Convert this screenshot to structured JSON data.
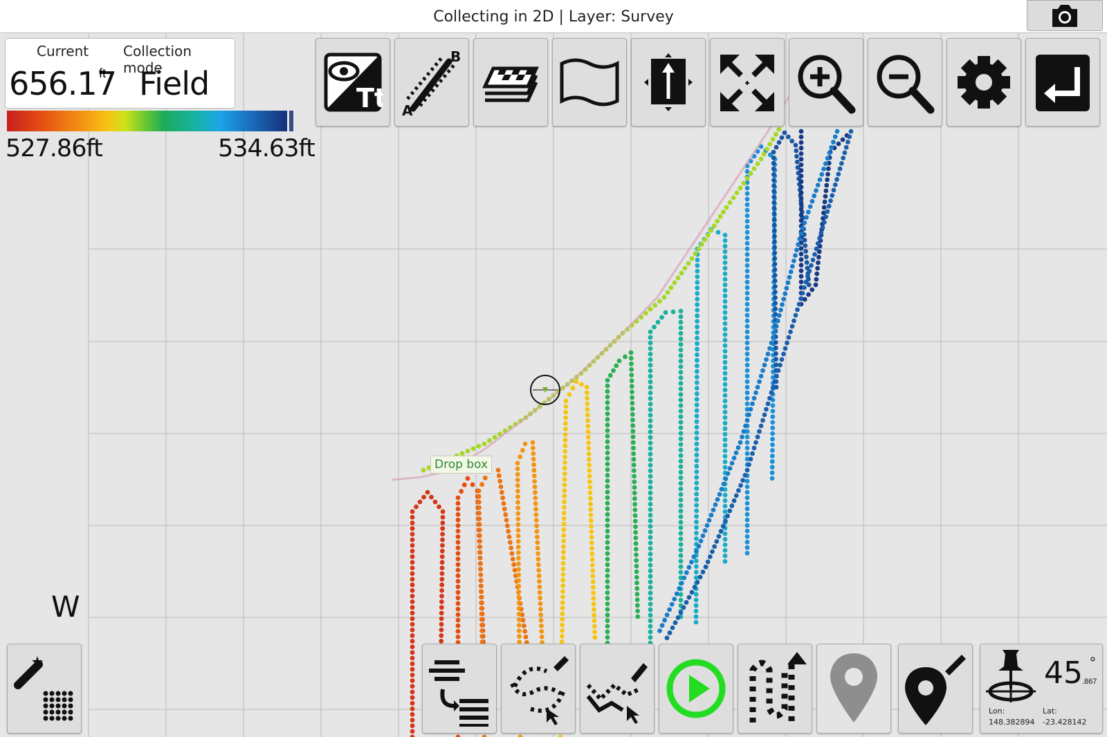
{
  "window": {
    "title": "Collecting in 2D | Layer: Survey"
  },
  "info": {
    "current_label": "Current",
    "current_value": "656.17",
    "current_unit": "ft",
    "mode_label": "Collection mode",
    "mode_value": "Field"
  },
  "legend": {
    "min": "527.86ft",
    "max": "534.63ft"
  },
  "compass": "W",
  "map_label": "Drop box",
  "gps": {
    "heading": "45",
    "heading_frac": ".867",
    "deg": "°",
    "lon_label": "Lon:",
    "lat_label": "Lat:",
    "lon": "148.382894",
    "lat": "-23.428142"
  },
  "toolbar_icons": [
    "visibility-label-icon",
    "ab-line-icon",
    "layers-icon",
    "map-icon",
    "north-up-icon",
    "zoom-extents-icon",
    "zoom-in-icon",
    "zoom-out-icon",
    "settings-icon",
    "exit-icon"
  ],
  "bottom_icons": [
    "auto-fill-grid-icon",
    "reorder-lines-icon",
    "edit-loop-icon",
    "edit-path-icon",
    "play-icon",
    "record-pattern-icon",
    "location-pin-icon",
    "edit-pin-icon",
    "gps-pin-icon"
  ],
  "colors": {
    "play_accent": "#22dd22",
    "grid_line": "#b9b9b9",
    "map_bg": "#e6e6e6"
  }
}
